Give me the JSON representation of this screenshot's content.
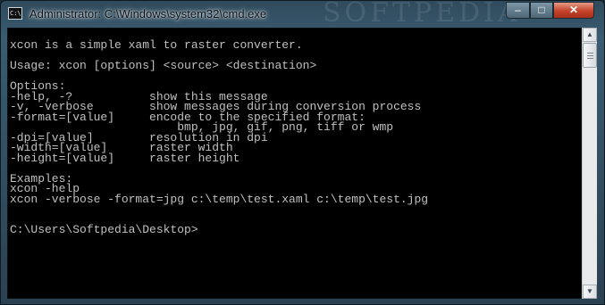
{
  "window": {
    "title": "Administrator: C:\\Windows\\system32\\cmd.exe",
    "icon": "console-icon",
    "icon_text": "C:\\",
    "watermark": "SOFTPEDIA"
  },
  "controls": {
    "minimize": "–",
    "maximize": "□",
    "close": "✕"
  },
  "console": {
    "lines": [
      "xcon is a simple xaml to raster converter.",
      "",
      "Usage: xcon [options] <source> <destination>",
      "",
      "Options:",
      "-help, -?           show this message",
      "-v, -verbose        show messages during conversion process",
      "-format=[value]     encode to the specified format:",
      "                        bmp, jpg, gif, png, tiff or wmp",
      "-dpi=[value]        resolution in dpi",
      "-width=[value]      raster width",
      "-height=[value]     raster height",
      "",
      "Examples:",
      "xcon -help",
      "xcon -verbose -format=jpg c:\\temp\\test.xaml c:\\temp\\test.jpg",
      "",
      "",
      "C:\\Users\\Softpedia\\Desktop>"
    ],
    "text_color": "#c0c0c0",
    "background": "#000000"
  },
  "scrollbar": {
    "up_arrow": "▲",
    "down_arrow": "▼"
  }
}
